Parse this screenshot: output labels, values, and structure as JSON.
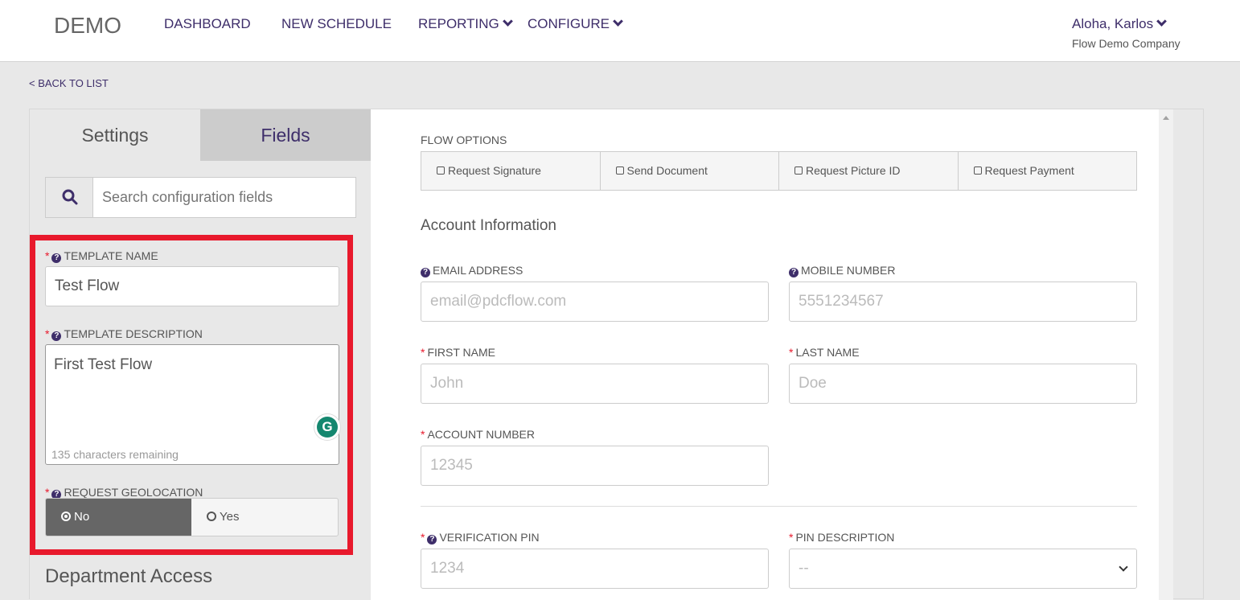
{
  "header": {
    "logo": "DEMO",
    "nav": [
      {
        "label": "DASHBOARD"
      },
      {
        "label": "NEW SCHEDULE"
      },
      {
        "label": "REPORTING"
      },
      {
        "label": "CONFIGURE"
      }
    ],
    "user": "Aloha, Karlos",
    "company": "Flow Demo Company"
  },
  "back_link": "< BACK TO LIST",
  "sidebar": {
    "tabs": [
      "Settings",
      "Fields"
    ],
    "search_placeholder": "Search configuration fields",
    "template_name": {
      "label": "TEMPLATE NAME",
      "value": "Test Flow"
    },
    "template_description": {
      "label": "TEMPLATE DESCRIPTION",
      "value": "First Test Flow",
      "remaining": "135 characters remaining"
    },
    "geolocation": {
      "label": "REQUEST GEOLOCATION",
      "options": [
        "No",
        "Yes"
      ],
      "selected": "No"
    },
    "department_access": "Department Access"
  },
  "main": {
    "flow_options_label": "FLOW OPTIONS",
    "flow_options": [
      "Request Signature",
      "Send Document",
      "Request Picture ID",
      "Request Payment"
    ],
    "section_title": "Account Information",
    "fields": {
      "email": {
        "label": "EMAIL ADDRESS",
        "placeholder": "email@pdcflow.com"
      },
      "mobile": {
        "label": "MOBILE NUMBER",
        "placeholder": "5551234567"
      },
      "first_name": {
        "label": "FIRST NAME",
        "placeholder": "John"
      },
      "last_name": {
        "label": "LAST NAME",
        "placeholder": "Doe"
      },
      "account_number": {
        "label": "ACCOUNT NUMBER",
        "placeholder": "12345"
      },
      "verification_pin": {
        "label": "VERIFICATION PIN",
        "placeholder": "1234"
      },
      "pin_description": {
        "label": "PIN DESCRIPTION",
        "value": "--"
      }
    }
  },
  "grammarly_letter": "G",
  "required_mark": "*",
  "help_mark": "?"
}
